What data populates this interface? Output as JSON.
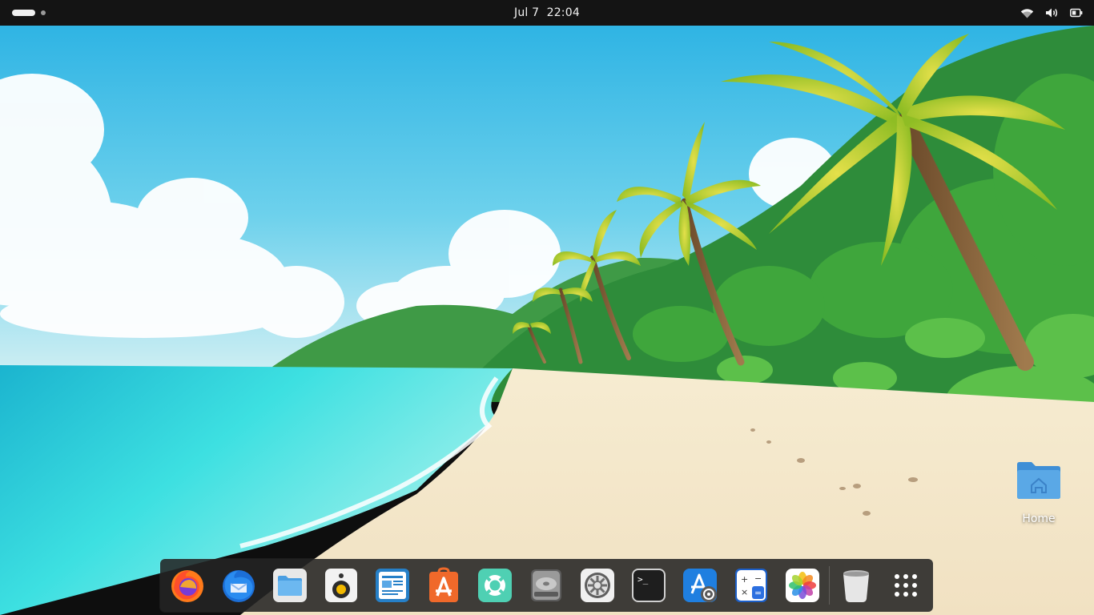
{
  "topbar": {
    "clock_date": "Jul 7",
    "clock_time": "22:04",
    "activities_icon": "workspace-indicator",
    "tray_icons": [
      "wifi-icon",
      "volume-icon",
      "battery-icon"
    ]
  },
  "desktop": {
    "icons": [
      {
        "label": "Home",
        "icon": "home-folder-icon"
      }
    ]
  },
  "dock": {
    "apps": [
      {
        "name": "firefox",
        "icon": "firefox-icon"
      },
      {
        "name": "thunderbird",
        "icon": "thunderbird-icon"
      },
      {
        "name": "files",
        "icon": "files-icon"
      },
      {
        "name": "rhythmbox",
        "icon": "speaker-icon"
      },
      {
        "name": "libreoffice-writer",
        "icon": "writer-icon"
      },
      {
        "name": "app-center",
        "icon": "app-store-icon"
      },
      {
        "name": "help",
        "icon": "help-lifebuoy-icon"
      },
      {
        "name": "disks",
        "icon": "disk-drive-icon"
      },
      {
        "name": "settings",
        "icon": "gear-icon"
      },
      {
        "name": "terminal",
        "icon": "terminal-icon"
      },
      {
        "name": "software-updater",
        "icon": "software-updater-icon"
      },
      {
        "name": "calculator",
        "icon": "calculator-icon"
      },
      {
        "name": "photos",
        "icon": "photos-icon"
      },
      {
        "name": "trash",
        "icon": "trash-icon"
      },
      {
        "name": "show-apps",
        "icon": "app-grid-icon"
      }
    ],
    "calculator_keys": [
      "+",
      "−",
      "×",
      "="
    ],
    "terminal_prompt": ">_"
  },
  "colors": {
    "topbar_bg": "#141414",
    "dock_bg": "#242424",
    "folder_blue": "#5aa8e6"
  }
}
